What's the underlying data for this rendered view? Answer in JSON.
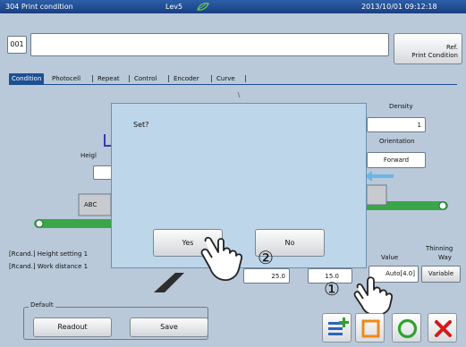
{
  "window": {
    "title": "304 Print condition",
    "level": "Lev5",
    "datetime": "2013/10/01 09:12:18"
  },
  "header": {
    "id_value": "001",
    "name_value": "",
    "ref_button_line1": "Ref.",
    "ref_button_line2": "Print Condition"
  },
  "tabs": [
    {
      "label": "Condition"
    },
    {
      "label": "Photocell"
    },
    {
      "label": "Repeat"
    },
    {
      "label": "Control"
    },
    {
      "label": "Encoder"
    },
    {
      "label": "Curve"
    }
  ],
  "panel": {
    "density_label": "Density",
    "density_value": "1",
    "orientation_label": "Orientation",
    "orientation_value": "Forward",
    "height_label_partial": "Heigl",
    "sample_text": "ABC",
    "height_setting_label": "[Rcand.] Height setting 1",
    "work_distance_label": "[Rcand.] Work distance 1",
    "value_a": "25.0",
    "value_b": "15.0",
    "thinning_label": "Thinning",
    "thinning_value_label": "Value",
    "thinning_way_label": "Way",
    "thinning_value": "Auto[4.0]",
    "thinning_way_value": "Variable"
  },
  "dialog": {
    "message": "Set?",
    "yes_label": "Yes",
    "no_label": "No"
  },
  "annotations": {
    "step2": "②",
    "step1": "①"
  },
  "default_group": {
    "legend": "Default",
    "readout_label": "Readout",
    "save_label": "Save"
  },
  "colors": {
    "title_bar": "#1d4f93",
    "background": "#b9c9d9",
    "dialog": "#bed6ea",
    "ok_green": "#2da32d",
    "cancel_red": "#d41a1a",
    "orange_square": "#f08a14",
    "conveyor_green": "#3aa64a"
  },
  "icons": {
    "new_item": "list-plus-icon",
    "square": "square-icon",
    "ok": "circle-ok-icon",
    "cancel": "cross-cancel-icon",
    "hand": "pointing-hand-icon"
  }
}
